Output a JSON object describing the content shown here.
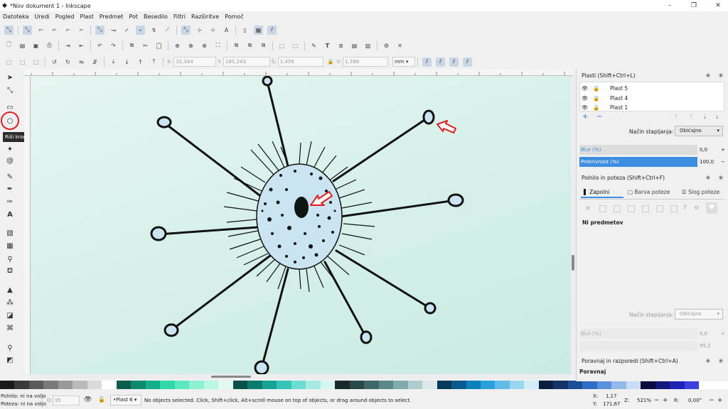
{
  "window": {
    "title": "*Nov dokument 1 - Inkscape"
  },
  "menu": [
    "Datoteka",
    "Uredi",
    "Pogled",
    "Plast",
    "Predmet",
    "Pot",
    "Besedilo",
    "Filtri",
    "Razširitve",
    "Pomoč"
  ],
  "transform_bar": {
    "x_label": "X:",
    "x_value": "32,344",
    "y_label": "Y:",
    "y_value": "165,243",
    "w_label": "Š:",
    "w_value": "1,456",
    "h_label": "V:",
    "h_value": "1,388",
    "unit": "mm"
  },
  "tooltip": "Riši kroge, elipse, loke (E)",
  "layers_panel": {
    "title": "Plasti  (Shift+Ctrl+L)",
    "layers": [
      "Plast 5",
      "Plast 4",
      "Plast 1"
    ],
    "blend_label": "Način stapljanja:",
    "blend_value": "Običajno",
    "blur_label": "Blur (%)",
    "blur_value": "0,0",
    "opacity_label": "Prekrivnost (%)",
    "opacity_value": "100,0"
  },
  "fill_panel": {
    "title": "Polnilo in poteza  (Shift+Ctrl+F)",
    "tabs": [
      "Zapolni",
      "Barva poteze",
      "Slog poteze"
    ],
    "no_objects": "Ni predmetov",
    "blend_label": "Način stapljanja:",
    "blend_value": "Običajno",
    "blur_label": "Blur (%)",
    "blur_value": "0,0",
    "opacity_value": "95,2"
  },
  "align_panel": {
    "title": "Poravnaj in razporedi  (Shift+Ctrl+A)",
    "sub": "Poravnaj"
  },
  "status": {
    "fill_label": "Polnilo:",
    "fill_value": "ni na voljo",
    "stroke_label": "Poteza:",
    "stroke_value": "ni na voljo",
    "opacity_label": "O:",
    "opacity_value": "95",
    "layer": "•Plast 6",
    "message": "No objects selected. Click, Shift+click, Alt+scroll mouse on top of objects, or drag around objects to select.",
    "cursor_x_label": "X:",
    "cursor_x": "1,17",
    "cursor_y_label": "Y:",
    "cursor_y": "171,67",
    "zoom_label": "Z:",
    "zoom": "521%",
    "rotate_label": "R:",
    "rotate": "0,00°"
  },
  "colors": {
    "highlight": "#3d8ee0",
    "cell_body": "#cbe4f1",
    "annotation_red": "#e02020"
  }
}
